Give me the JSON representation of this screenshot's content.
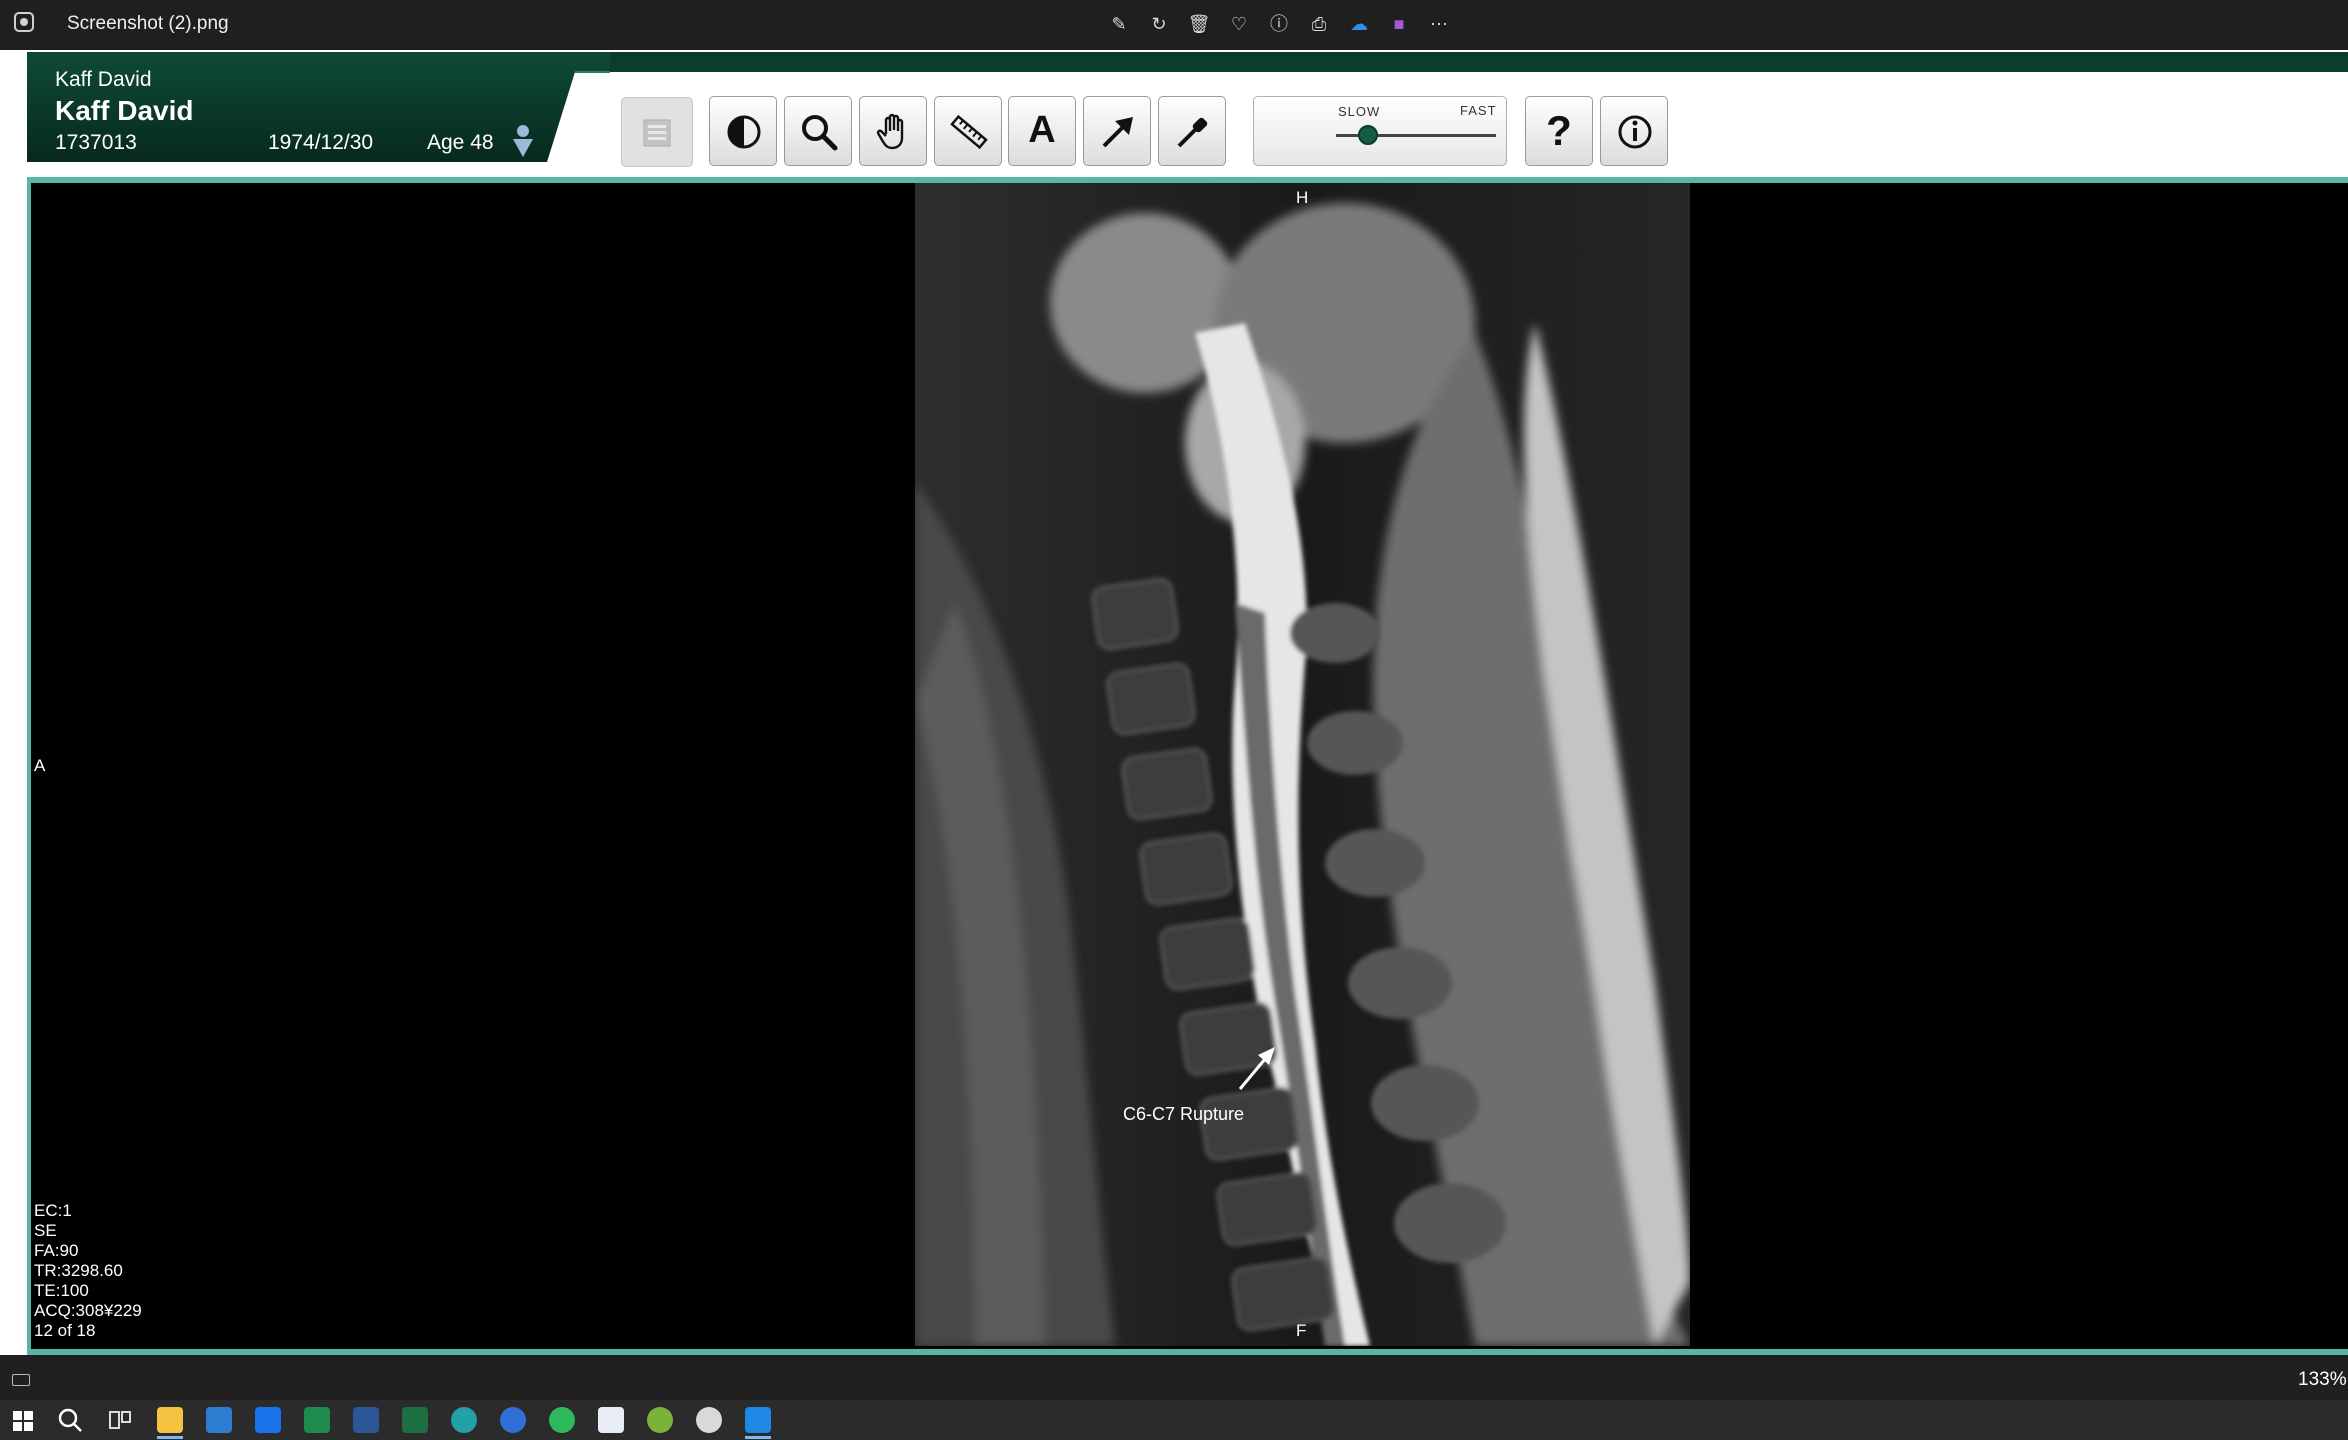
{
  "window": {
    "title": "Screenshot (2).png"
  },
  "patient": {
    "first_line": "Kaff David",
    "name": "Kaff David",
    "id": "1737013",
    "dob": "1974/12/30",
    "age": "Age 48"
  },
  "toolbar": {
    "speed_slow": "SLOW",
    "speed_fast": "FAST",
    "speed_value": 0.2,
    "text_tool_glyph": "A",
    "help_glyph": "?"
  },
  "image": {
    "orientation_top": "H",
    "orientation_bottom": "F",
    "orientation_left": "A",
    "annotation": "C6-C7 Rupture",
    "info": {
      "ec": "EC:1",
      "se": "SE",
      "fa": "FA:90",
      "tr": "TR:3298.60",
      "te": "TE:100",
      "acq": "ACQ:308¥229",
      "slice": "12 of 18"
    }
  },
  "status": {
    "zoom": "133%"
  },
  "colors": {
    "accent_dark": "#0b3d2e",
    "frame": "#5ab5a5"
  }
}
